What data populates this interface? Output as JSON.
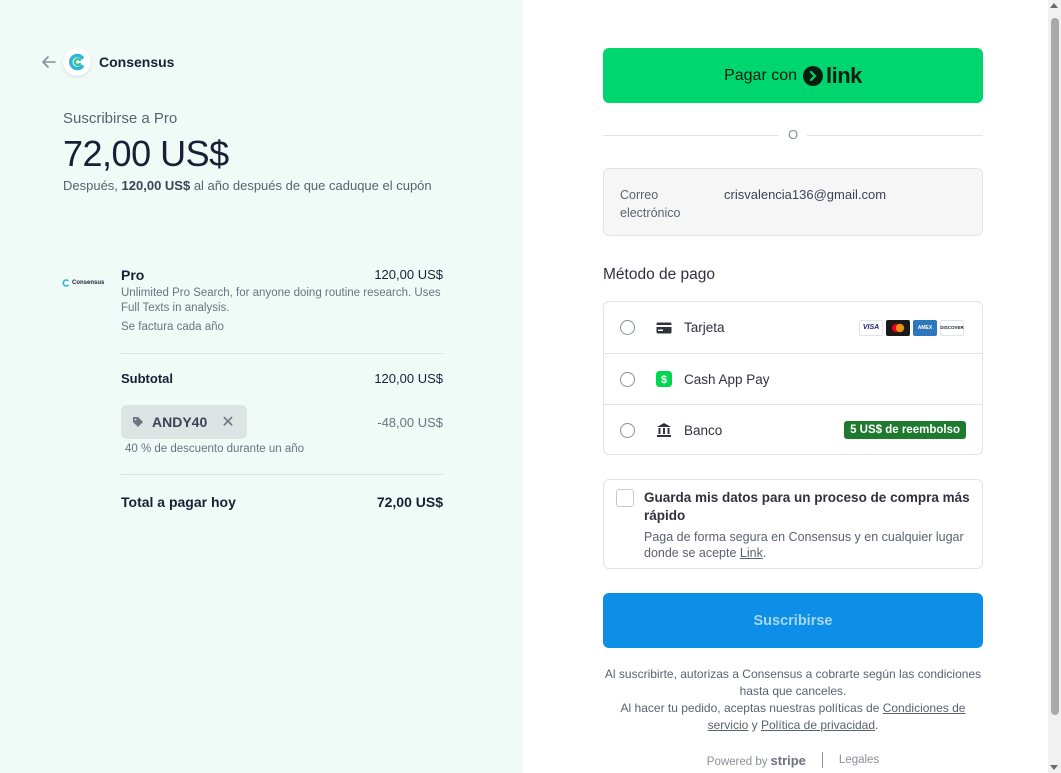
{
  "header": {
    "brand_name": "Consensus",
    "back_icon": "arrow-left-icon"
  },
  "summary": {
    "subtitle": "Suscribirse a Pro",
    "price": "72,00 US$",
    "after_prefix": "Después, ",
    "after_amount": "120,00 US$",
    "after_suffix": " al año después de que caduque el cupón"
  },
  "line_item": {
    "logo_text": "Consensus",
    "name": "Pro",
    "price": "120,00 US$",
    "description": "Unlimited Pro Search, for anyone doing routine research. Uses Full Texts in analysis.",
    "billing": "Se factura cada año"
  },
  "totals": {
    "subtotal_label": "Subtotal",
    "subtotal_value": "120,00 US$",
    "coupon_code": "ANDY40",
    "discount_value": "-48,00 US$",
    "discount_note": "40 % de descuento durante un año",
    "total_label": "Total a pagar hoy",
    "total_value": "72,00 US$"
  },
  "checkout": {
    "link_button_prefix": "Pagar con",
    "link_button_brand": "link",
    "or_text": "O",
    "email_label": "Correo electrónico",
    "email_value": "crisvalencia136@gmail.com",
    "payment_method_title": "Método de pago",
    "methods": [
      {
        "label": "Tarjeta",
        "icon": "credit-card-icon"
      },
      {
        "label": "Cash App Pay",
        "icon": "cash-app-icon"
      },
      {
        "label": "Banco",
        "icon": "bank-icon",
        "badge": "5 US$ de reembolso"
      }
    ],
    "card_brands": [
      "VISA",
      "mastercard",
      "AMEX",
      "DISCOVER"
    ],
    "save_title": "Guarda mis datos para un proceso de compra más rápido",
    "save_desc_prefix": "Paga de forma segura en Consensus y en cualquier lugar donde se acepte ",
    "save_desc_link": "Link",
    "save_desc_suffix": ".",
    "subscribe_label": "Suscribirse",
    "legal_line1": "Al suscribirte, autorizas a Consensus a cobrarte según las condiciones hasta que canceles.",
    "legal_line2_prefix": "Al hacer tu pedido, aceptas nuestras políticas de ",
    "legal_terms": "Condiciones de servicio",
    "legal_and": " y ",
    "legal_privacy": "Política de privacidad",
    "legal_end": ".",
    "powered_by": "Powered by",
    "stripe": "stripe",
    "legales": "Legales"
  },
  "colors": {
    "link_green": "#00d66f",
    "subscribe_blue": "#0d8fe8",
    "left_panel_bg": "#f0faf7",
    "bank_badge_green": "#1e7a2e"
  }
}
